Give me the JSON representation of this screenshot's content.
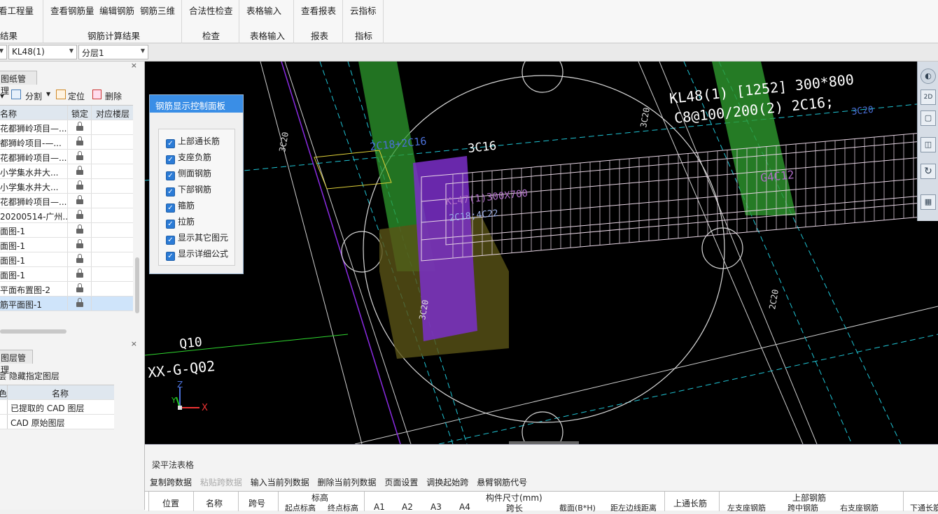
{
  "ribbon": {
    "groups": [
      {
        "buttons": [
          "看工程量"
        ],
        "label": "结果"
      },
      {
        "buttons": [
          "查看钢筋量",
          "编辑钢筋",
          "钢筋三维"
        ],
        "label": "钢筋计算结果"
      },
      {
        "buttons": [
          "合法性检查"
        ],
        "label": "检查"
      },
      {
        "buttons": [
          "表格输入"
        ],
        "label": "表格输入"
      },
      {
        "buttons": [
          "查看报表"
        ],
        "label": "报表"
      },
      {
        "buttons": [
          "云指标"
        ],
        "label": "指标"
      }
    ]
  },
  "selectors": {
    "component": "KL48(1)",
    "layer": "分层1"
  },
  "drawing_panel": {
    "tab": "图纸管理",
    "toolbar": {
      "split": "分割",
      "locate": "定位",
      "delete": "删除"
    },
    "columns": [
      "名称",
      "锁定",
      "对应楼层"
    ],
    "rows": [
      "花都狮岭项目—...",
      "都狮岭项目-—...",
      "花都狮岭项目—...",
      "小学集水井大...",
      "小学集水井大...",
      "花都狮岭项目—...",
      "20200514-广州...",
      "面图-1",
      "面图-1",
      "面图-1",
      "面图-1",
      "平面布置图-2",
      "筋平面图-1"
    ]
  },
  "layer_panel": {
    "tab": "图层管理",
    "hide_label": "隐藏指定图层",
    "columns": [
      "色",
      "名称"
    ],
    "rows": [
      "已提取的 CAD 图层",
      "CAD 原始图层"
    ]
  },
  "rebar_panel": {
    "title": "钢筋显示控制面板",
    "options": [
      "上部通长筋",
      "支座负筋",
      "侧面钢筋",
      "下部钢筋",
      "箍筋",
      "拉筋",
      "显示其它图元",
      "显示详细公式"
    ]
  },
  "canvas_text": {
    "beam_line1": "KL48(1) [1252] 300*800",
    "beam_line2": "C8@100/200(2) 2C16;",
    "beam_side": "G4C12",
    "label_3c16": "3C16",
    "label_2c18": "2C18+2C16",
    "kl47_line1": "KL47(1)300X700",
    "kl47_line2": "2C18;4C22",
    "q10": "Q10",
    "xxg": "XX-G-Q02",
    "v1": "3C20",
    "v2": "3C20",
    "v3": "2C20",
    "v4": "3C20",
    "v5": "3C20",
    "axis_z": "Z",
    "axis_y": "Y",
    "axis_x": "X"
  },
  "view_toolbar": [
    "2D"
  ],
  "table": {
    "title": "梁平法表格",
    "toolbar": [
      "复制跨数据",
      "粘贴跨数据",
      "输入当前列数据",
      "删除当前列数据",
      "页面设置",
      "调换起始跨",
      "悬臂钢筋代号"
    ],
    "headers": {
      "position": "位置",
      "name": "名称",
      "span": "跨号",
      "elev": "标高",
      "start_elev": "起点标高",
      "end_elev": "终点标高",
      "dims": "构件尺寸(mm)",
      "a1": "A1",
      "a2": "A2",
      "a3": "A3",
      "a4": "A4",
      "span_len": "跨长",
      "section": "截面(B*H)",
      "offset": "距左边线距离",
      "top_long": "上通长筋",
      "top_rebar": "上部钢筋",
      "left_sup": "左支座钢筋",
      "mid": "跨中钢筋",
      "right_sup": "右支座钢筋",
      "bottom_long": "下通长筋"
    }
  },
  "colors": {
    "canvas_bg": "#000000",
    "beam_green": "#2a8a2a",
    "column_purple": "#7b2fc9",
    "panel_blue": "#3a8ee6"
  }
}
